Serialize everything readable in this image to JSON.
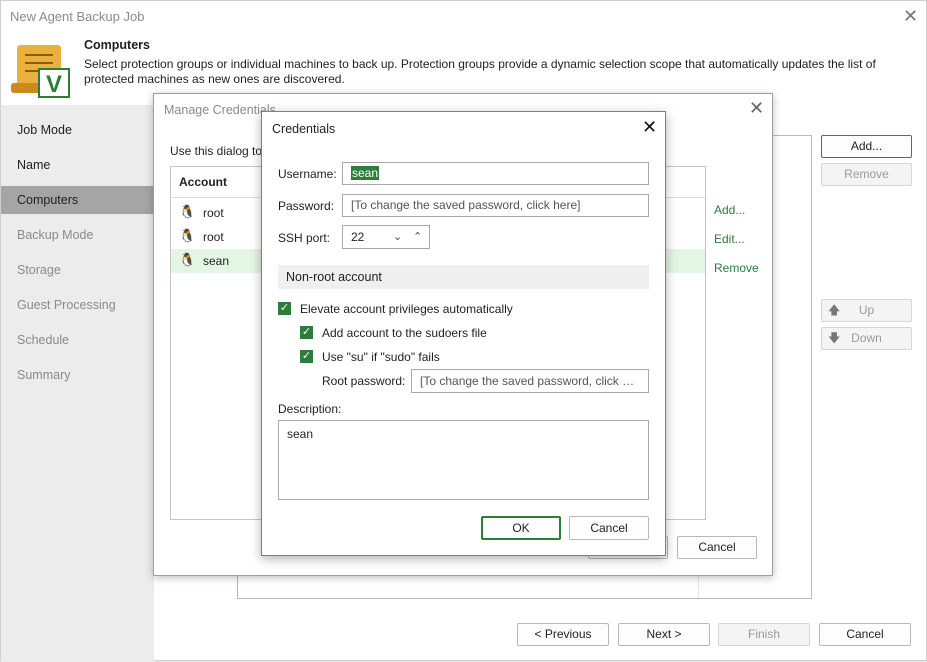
{
  "wizard": {
    "title": "New Agent Backup Job",
    "header_title": "Computers",
    "header_desc_1": "Select protection groups or individual machines to back up. Protection groups provide a dynamic selection scope that automatically updates the list of",
    "header_desc_2": "protected machines as new ones are discovered.",
    "nav": [
      {
        "label": "Job Mode"
      },
      {
        "label": "Name"
      },
      {
        "label": "Computers"
      },
      {
        "label": "Backup Mode"
      },
      {
        "label": "Storage"
      },
      {
        "label": "Guest Processing"
      },
      {
        "label": "Schedule"
      },
      {
        "label": "Summary"
      }
    ],
    "add": "Add...",
    "remove": "Remove",
    "up": "Up",
    "down": "Down",
    "previous": "< Previous",
    "next": "Next >",
    "finish": "Finish",
    "cancel": "Cancel"
  },
  "manage": {
    "title": "Manage Credentials",
    "intro": "Use this dialog to",
    "column_account": "Account",
    "accounts": [
      {
        "name": "root"
      },
      {
        "name": "root"
      },
      {
        "name": "sean"
      }
    ],
    "add": "Add...",
    "edit": "Edit...",
    "remove": "Remove",
    "cancel": "Cancel"
  },
  "cred": {
    "title": "Credentials",
    "username_label": "Username:",
    "username_value": "sean",
    "password_label": "Password:",
    "password_placeholder": "[To change the saved password, click here]",
    "ssh_label": "SSH port:",
    "ssh_value": "22",
    "nonroot_section": "Non-root account",
    "elevate": "Elevate account privileges automatically",
    "sudoers": "Add account to the sudoers file",
    "use_su": "Use \"su\" if \"sudo\" fails",
    "root_pw_label": "Root password:",
    "root_pw_placeholder": "[To change the saved password, click he...",
    "description_label": "Description:",
    "description_value": "sean",
    "ok": "OK",
    "cancel": "Cancel"
  },
  "colors": {
    "accent": "#2e7d3a",
    "selected_row": "#e3f5e3",
    "nav_selected": "#a5a5a5"
  }
}
